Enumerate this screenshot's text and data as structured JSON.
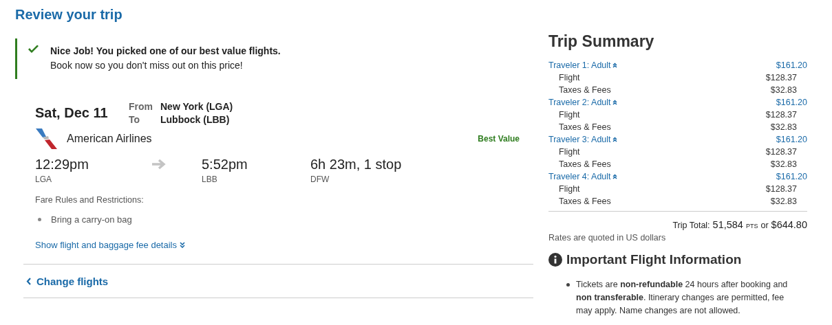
{
  "page_title": "Review your trip",
  "notice": {
    "headline": "Nice Job! You picked one of our best value flights.",
    "message": "Book now so you don't miss out on this price!"
  },
  "flight": {
    "date": "Sat, Dec 11",
    "from_label": "From",
    "from": "New York (LGA)",
    "to_label": "To",
    "to": "Lubbock (LBB)",
    "airline": "American Airlines",
    "badge": "Best Value",
    "depart_time": "12:29pm",
    "depart_airport": "LGA",
    "arrive_time": "5:52pm",
    "arrive_airport": "LBB",
    "duration": "6h 23m, 1 stop",
    "stop_airport": "DFW",
    "fare_rules_title": "Fare Rules and Restrictions:",
    "fare_rules": [
      "Bring a carry-on bag"
    ],
    "details_link": "Show flight and baggage fee details"
  },
  "change_flights": "Change flights",
  "summary": {
    "title": "Trip Summary",
    "travelers": [
      {
        "label": "Traveler 1: Adult",
        "total": "$161.20",
        "expanded": true,
        "lines": [
          {
            "label": "Flight",
            "amount": "$128.37"
          },
          {
            "label": "Taxes & Fees",
            "amount": "$32.83"
          }
        ]
      },
      {
        "label": "Traveler 2: Adult",
        "total": "$161.20",
        "expanded": true,
        "lines": [
          {
            "label": "Flight",
            "amount": "$128.37"
          },
          {
            "label": "Taxes & Fees",
            "amount": "$32.83"
          }
        ]
      },
      {
        "label": "Traveler 3: Adult",
        "total": "$161.20",
        "expanded": true,
        "lines": [
          {
            "label": "Flight",
            "amount": "$128.37"
          },
          {
            "label": "Taxes & Fees",
            "amount": "$32.83"
          }
        ]
      },
      {
        "label": "Traveler 4: Adult",
        "total": "$161.20",
        "expanded": true,
        "lines": [
          {
            "label": "Flight",
            "amount": "$128.37"
          },
          {
            "label": "Taxes & Fees",
            "amount": "$32.83"
          }
        ]
      }
    ],
    "total_label": "Trip Total:",
    "total_points": "51,584",
    "points_unit": "PTS",
    "total_or": "or",
    "total_amount": "$644.80",
    "rates_note": "Rates are quoted in US dollars"
  },
  "important": {
    "title": "Important Flight Information",
    "items": [
      "Tickets are **non-refundable** 24 hours after booking and **non transferable**. Itinerary changes are permitted, fee may apply. Name changes are not allowed."
    ]
  }
}
